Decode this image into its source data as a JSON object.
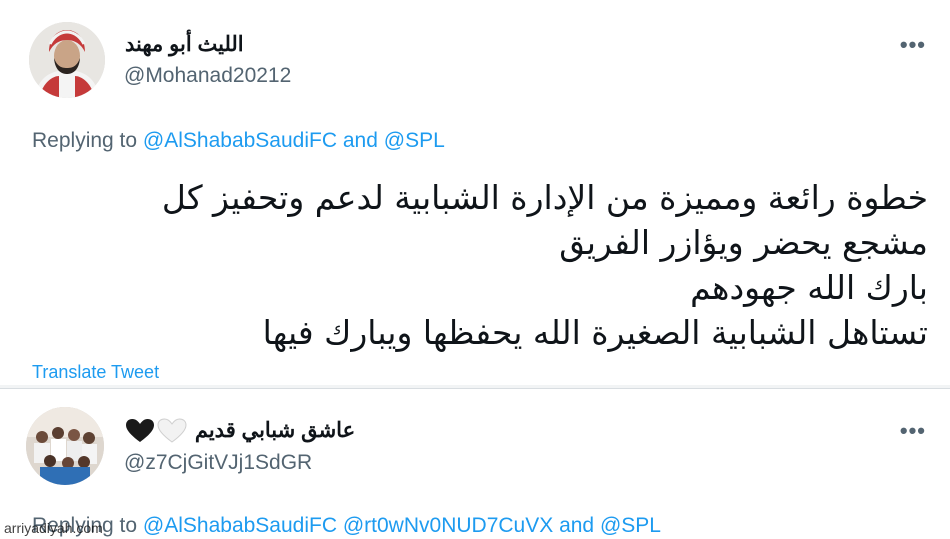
{
  "tweets": [
    {
      "display_name": "الليث أبو مهند",
      "handle": "@Mohanad20212",
      "replying_prefix": "Replying to",
      "mention_1": "@AlShababSaudiFC",
      "connector_and": "and",
      "mention_2": "@SPL",
      "body_lines": [
        "خطوة رائعة ومميزة من الإدارة الشبابية لدعم وتحفيز كل",
        "مشجع يحضر ويؤازر الفريق",
        "بارك الله جهودهم",
        "تستاهل الشبابية الصغيرة الله يحفظها ويبارك فيها"
      ],
      "translate_label": "Translate Tweet",
      "more_icon": "more-horizontal-icon"
    },
    {
      "display_name": "عاشق شبابي قديم",
      "handle": "@z7CjGitVJj1SdGR",
      "replying_prefix": "Replying to",
      "mention_1": "@AlShababSaudiFC",
      "mention_2": "@rt0wNv0NUD7CuVX",
      "connector_and": "and",
      "mention_3": "@SPL",
      "name_emoji": [
        "black-heart-icon",
        "white-heart-icon"
      ],
      "more_icon": "more-horizontal-icon"
    }
  ],
  "watermark": "arriyadiyah.com",
  "colors": {
    "link": "#1d9bf0",
    "secondary_text": "#536471",
    "primary_text": "#0f1419"
  }
}
